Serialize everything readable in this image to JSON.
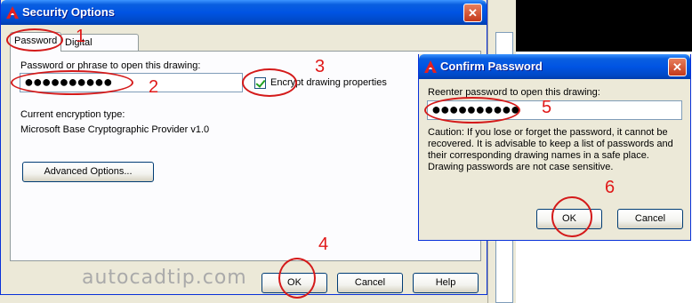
{
  "security_dialog": {
    "title": "Security Options",
    "close": "✕",
    "tabs": [
      "Password",
      "Digital Signature"
    ],
    "password_label": "Password or phrase to open this drawing:",
    "password_value": "●●●●●●●●●●",
    "encrypt_label": "Encrypt drawing properties",
    "encrypt_checked": true,
    "encryption_type_label": "Current encryption type:",
    "encryption_type_value": "Microsoft Base Cryptographic Provider v1.0",
    "advanced_button": "Advanced Options...",
    "ok_button": "OK",
    "cancel_button": "Cancel",
    "help_button": "Help"
  },
  "confirm_dialog": {
    "title": "Confirm Password",
    "close": "✕",
    "reenter_label": "Reenter password to open this drawing:",
    "password_value": "●●●●●●●●●●",
    "caution_text": "Caution: If you lose or forget the password, it cannot be recovered.  It is advisable to keep a list of passwords and their corresponding drawing names in a safe place.  Drawing passwords are not case sensitive.",
    "ok_button": "OK",
    "cancel_button": "Cancel"
  },
  "annotations": [
    "1",
    "2",
    "3",
    "4",
    "5",
    "6"
  ],
  "watermark": "autocadtip.com",
  "colors": {
    "titlebar": "#0054e3",
    "dialog_bg": "#ece9d8",
    "annotation": "#d41a1a",
    "watermark": "#aaaaaa"
  },
  "icons": {
    "app": "autocad-a-icon",
    "close": "close-icon",
    "check": "check-icon"
  }
}
